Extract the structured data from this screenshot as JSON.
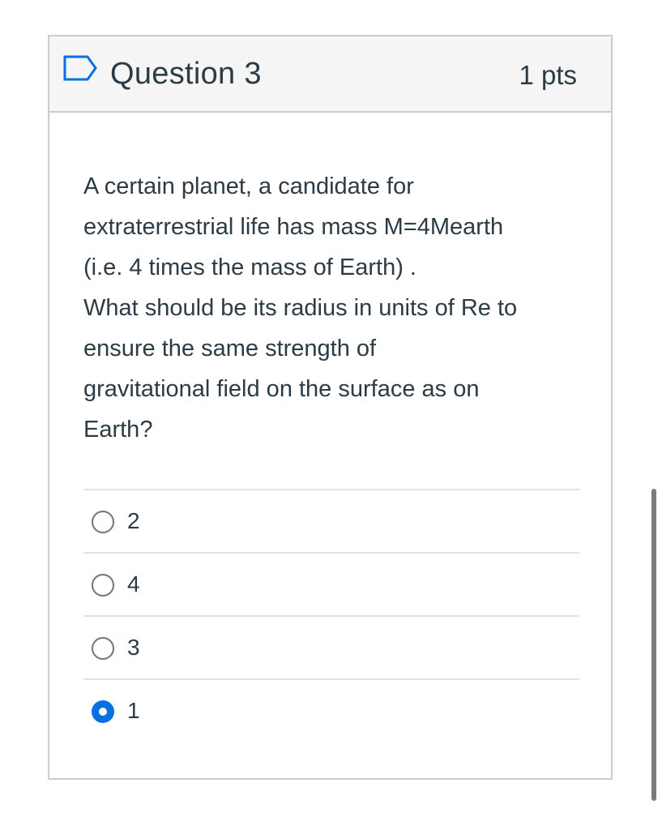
{
  "question": {
    "title": "Question 3",
    "points": "1 pts",
    "text_lines": [
      "A certain planet, a candidate for",
      "extraterrestrial life has mass M=4Mearth",
      "(i.e. 4 times the mass of Earth) .",
      "What should be its radius in units of Re to",
      "ensure the same strength of",
      "gravitational field on the surface as on",
      "Earth?"
    ]
  },
  "answers": [
    {
      "label": "2",
      "selected": false
    },
    {
      "label": "4",
      "selected": false
    },
    {
      "label": "3",
      "selected": false
    },
    {
      "label": "1",
      "selected": true
    }
  ],
  "icons": {
    "flag": "bookmark-flag-icon"
  },
  "colors": {
    "selected_radio": "#0770e3",
    "header_bg": "#f5f5f5",
    "border": "#c7cdd1",
    "text": "#2d3b45"
  }
}
